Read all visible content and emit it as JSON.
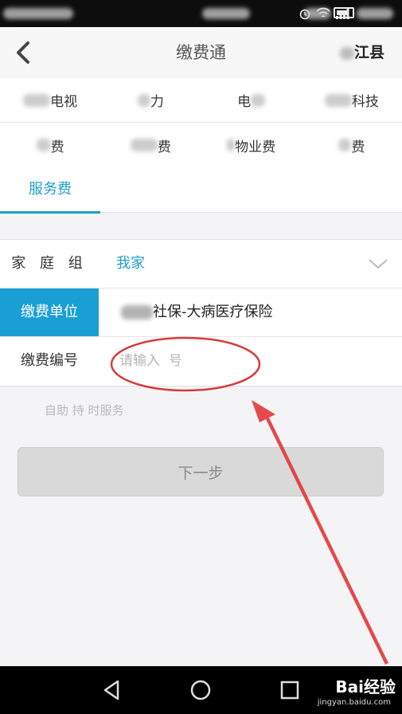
{
  "nav": {
    "title": "缴费通",
    "region": "江县"
  },
  "categories": {
    "row1": [
      "电视",
      "力",
      "电",
      "科技"
    ],
    "row2": [
      "费",
      "费",
      "物业费",
      "费"
    ]
  },
  "tabs": [
    {
      "label": "服务费",
      "active": true
    }
  ],
  "form": {
    "family_label": "家 庭 组",
    "family_value": "我家",
    "unit_label": "缴费单位",
    "unit_value": "社保-大病医疗保险",
    "number_label": "缴费编号",
    "number_placeholder": "请输入  号",
    "number_value": ""
  },
  "hint": "自助  持  时服务",
  "next_button": "下一步",
  "watermark": {
    "brand": "Bai经验",
    "url": "jingyan.baidu.com"
  },
  "colors": {
    "accent": "#1f9fc9",
    "highlight": "#1a9fd4",
    "annotation": "#e23b3b"
  }
}
